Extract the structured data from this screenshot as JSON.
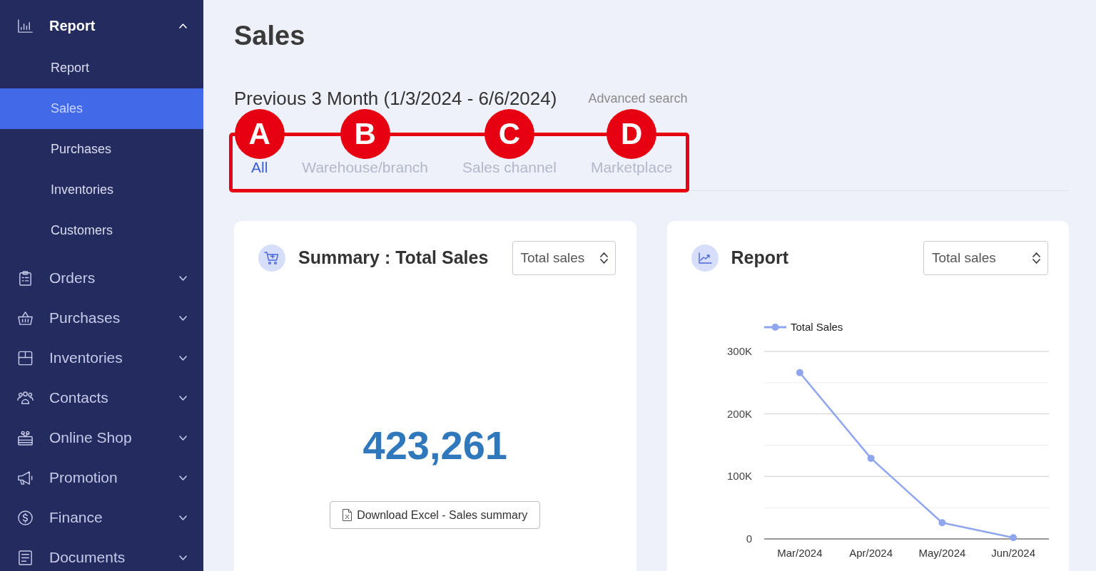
{
  "sidebar": {
    "items": [
      {
        "label": "Report",
        "expanded": true,
        "children": [
          {
            "label": "Report",
            "selected": false
          },
          {
            "label": "Sales",
            "selected": true
          },
          {
            "label": "Purchases",
            "selected": false
          },
          {
            "label": "Inventories",
            "selected": false
          },
          {
            "label": "Customers",
            "selected": false
          }
        ]
      },
      {
        "label": "Orders",
        "expanded": false
      },
      {
        "label": "Purchases",
        "expanded": false
      },
      {
        "label": "Inventories",
        "expanded": false
      },
      {
        "label": "Contacts",
        "expanded": false
      },
      {
        "label": "Online Shop",
        "expanded": false
      },
      {
        "label": "Promotion",
        "expanded": false
      },
      {
        "label": "Finance",
        "expanded": false
      },
      {
        "label": "Documents",
        "expanded": false
      }
    ]
  },
  "page": {
    "title": "Sales",
    "period": "Previous 3 Month (1/3/2024 - 6/6/2024)",
    "advanced_search": "Advanced search"
  },
  "tabs": [
    {
      "label": "All",
      "selected": true
    },
    {
      "label": "Warehouse/branch",
      "selected": false
    },
    {
      "label": "Sales channel",
      "selected": false
    },
    {
      "label": "Marketplace",
      "selected": false
    }
  ],
  "annotations": {
    "markers": [
      "A",
      "B",
      "C",
      "D"
    ]
  },
  "summary_card": {
    "title": "Summary : Total Sales",
    "select_value": "Total sales",
    "total": "423,261",
    "download_button": "Download Excel - Sales summary"
  },
  "report_card": {
    "title": "Report",
    "select_value": "Total sales",
    "chart_data": {
      "type": "line",
      "categories": [
        "Mar/2024",
        "Apr/2024",
        "May/2024",
        "Jun/2024"
      ],
      "series": [
        {
          "name": "Total Sales",
          "color": "#8fa6ef",
          "marker": "circle",
          "values": [
            266000,
            129000,
            26000,
            2000
          ]
        }
      ],
      "ylim": [
        0,
        300000
      ],
      "yticks": [
        {
          "value": 0,
          "label": "0"
        },
        {
          "value": 100000,
          "label": "100K"
        },
        {
          "value": 200000,
          "label": "200K"
        },
        {
          "value": 300000,
          "label": "300K"
        }
      ]
    }
  }
}
